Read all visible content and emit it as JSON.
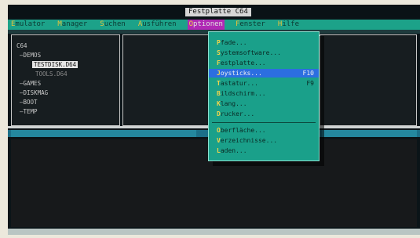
{
  "app": {
    "title": "Festplatte C64"
  },
  "menubar": {
    "items": [
      {
        "hotkey": "E",
        "rest": "mulator"
      },
      {
        "hotkey": "M",
        "rest": "anager"
      },
      {
        "hotkey": "S",
        "rest": "uchen"
      },
      {
        "hotkey": "A",
        "rest": "usführen"
      },
      {
        "hotkey": "O",
        "rest": "ptionen"
      },
      {
        "hotkey": "F",
        "rest": "enster"
      },
      {
        "hotkey": "H",
        "rest": "ilfe"
      }
    ],
    "active_index": 4
  },
  "tree": {
    "items": [
      {
        "text": "C64",
        "state": "normal"
      },
      {
        "text": "—DEMOS",
        "state": "normal"
      },
      {
        "text": "TESTDISK.D64",
        "state": "selected"
      },
      {
        "text": "TOOLS.D64",
        "state": "dim"
      },
      {
        "text": "—GAMES",
        "state": "normal"
      },
      {
        "text": "—DISKMAG",
        "state": "normal"
      },
      {
        "text": "—BOOT",
        "state": "normal"
      },
      {
        "text": "—TEMP",
        "state": "normal"
      }
    ]
  },
  "options_menu": {
    "items": [
      {
        "hotkey": "P",
        "rest": "fade...",
        "shortcut": "",
        "selected": false
      },
      {
        "hotkey": "S",
        "rest": "ystemsoftware...",
        "shortcut": "",
        "selected": false
      },
      {
        "hotkey": "F",
        "rest": "estplatte...",
        "shortcut": "",
        "selected": false
      },
      {
        "hotkey": "J",
        "rest": "oysticks...",
        "shortcut": "F10",
        "selected": true
      },
      {
        "hotkey": "T",
        "rest": "astatur...",
        "shortcut": "F9",
        "selected": false
      },
      {
        "hotkey": "B",
        "rest": "ildschirm...",
        "shortcut": "",
        "selected": false
      },
      {
        "hotkey": "K",
        "rest": "lang...",
        "shortcut": "",
        "selected": false
      },
      {
        "hotkey": "D",
        "rest": "rucker...",
        "shortcut": "",
        "selected": false
      },
      {
        "hotkey": "O",
        "rest": "berfläche...",
        "shortcut": "",
        "selected": false
      },
      {
        "hotkey": "V",
        "rest": "erzeichnisse...",
        "shortcut": "",
        "selected": false
      },
      {
        "hotkey": "L",
        "rest": "aden...",
        "shortcut": "",
        "selected": false
      }
    ]
  },
  "colors": {
    "menubar": "#1ca289",
    "menu_highlight": "#b02ab5",
    "dropdown_bg": "#1aa08a",
    "selection": "#2c6ee0",
    "hotkey": "#f4d54a",
    "screen_bg": "#0b1418"
  }
}
